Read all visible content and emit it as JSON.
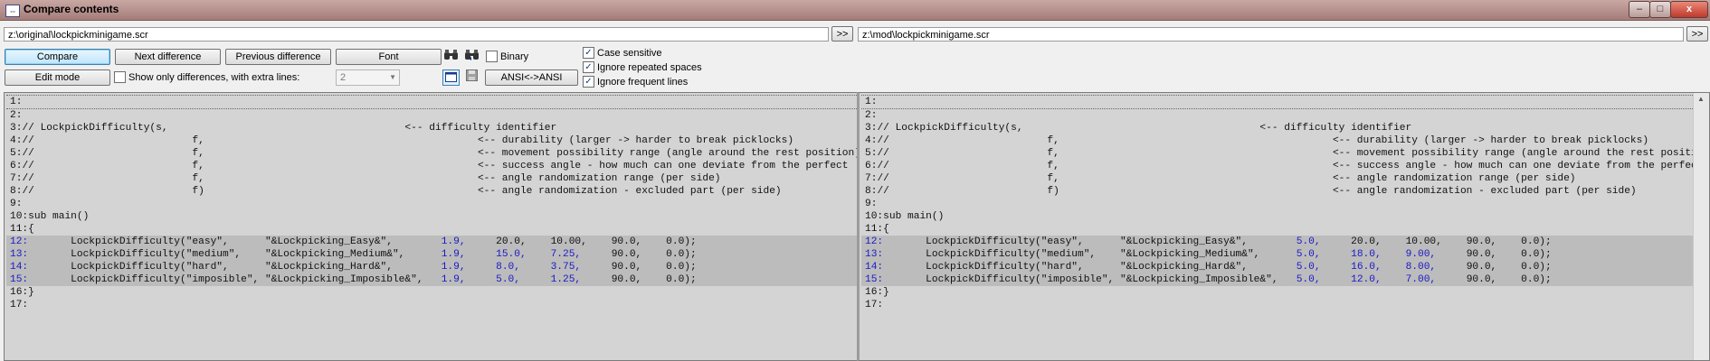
{
  "window": {
    "title": "Compare contents",
    "minimize": "–",
    "maximize": "□",
    "close": "x"
  },
  "files": {
    "left": "z:\\original\\lockpickminigame.scr",
    "right": "z:\\mod\\lockpickminigame.scr",
    "browse_label": ">>"
  },
  "toolbar": {
    "compare": "Compare",
    "next_difference": "Next difference",
    "previous_difference": "Previous difference",
    "font": "Font",
    "edit_mode": "Edit mode",
    "ansi": "ANSI<->ANSI",
    "extra_lines_value": "2"
  },
  "options": {
    "binary": {
      "label": "Binary",
      "checked": false
    },
    "show_only_differences": {
      "label": "Show only differences, with extra lines:",
      "checked": false
    },
    "case_sensitive": {
      "label": "Case sensitive",
      "checked": true
    },
    "ignore_repeated_spaces": {
      "label": "Ignore repeated spaces",
      "checked": true
    },
    "ignore_frequent_lines": {
      "label": "Ignore frequent lines",
      "checked": true
    }
  },
  "left_lines": [
    {
      "n": "1:",
      "t": ""
    },
    {
      "n": "2:",
      "t": ""
    },
    {
      "n": "3:",
      "t": "// LockpickDifficulty(s,                                       <-- difficulty identifier"
    },
    {
      "n": "4:",
      "t": "//                          f,                                             <-- durability (larger -> harder to break picklocks)"
    },
    {
      "n": "5:",
      "t": "//                          f,                                             <-- movement possibility range (angle around the rest position)"
    },
    {
      "n": "6:",
      "t": "//                          f,                                             <-- success angle - how much can one deviate from the perfect"
    },
    {
      "n": "7:",
      "t": "//                          f,                                             <-- angle randomization range (per side)"
    },
    {
      "n": "8:",
      "t": "//                          f)                                             <-- angle randomization - excluded part (per side)"
    },
    {
      "n": "9:",
      "t": ""
    },
    {
      "n": "10:",
      "t": "sub main()"
    },
    {
      "n": "11:",
      "t": "{"
    },
    {
      "n": "12:",
      "t": "       LockpickDifficulty(\"easy\",      \"&Lockpicking_Easy&\",        ",
      "v": [
        "1.9,",
        "20.0,",
        "10.00,",
        "90.0,",
        "0.0);"
      ]
    },
    {
      "n": "13:",
      "t": "       LockpickDifficulty(\"medium\",    \"&Lockpicking_Medium&\",      ",
      "v": [
        "1.9,",
        "15.0,",
        "7.25,",
        "90.0,",
        "0.0);"
      ]
    },
    {
      "n": "14:",
      "t": "       LockpickDifficulty(\"hard\",      \"&Lockpicking_Hard&\",        ",
      "v": [
        "1.9,",
        "8.0,",
        "3.75,",
        "90.0,",
        "0.0);"
      ]
    },
    {
      "n": "15:",
      "t": "       LockpickDifficulty(\"imposible\", \"&Lockpicking_Imposible&\",   ",
      "v": [
        "1.9,",
        "5.0,",
        "1.25,",
        "90.0,",
        "0.0);"
      ]
    },
    {
      "n": "16:",
      "t": "}"
    },
    {
      "n": "17:",
      "t": ""
    }
  ],
  "right_lines": [
    {
      "n": "1:",
      "t": ""
    },
    {
      "n": "2:",
      "t": ""
    },
    {
      "n": "3:",
      "t": "// LockpickDifficulty(s,                                       <-- difficulty identifier"
    },
    {
      "n": "4:",
      "t": "//                          f,                                             <-- durability (larger -> harder to break picklocks)"
    },
    {
      "n": "5:",
      "t": "//                          f,                                             <-- movement possibility range (angle around the rest position)"
    },
    {
      "n": "6:",
      "t": "//                          f,                                             <-- success angle - how much can one deviate from the perfect"
    },
    {
      "n": "7:",
      "t": "//                          f,                                             <-- angle randomization range (per side)"
    },
    {
      "n": "8:",
      "t": "//                          f)                                             <-- angle randomization - excluded part (per side)"
    },
    {
      "n": "9:",
      "t": ""
    },
    {
      "n": "10:",
      "t": "sub main()"
    },
    {
      "n": "11:",
      "t": "{"
    },
    {
      "n": "12:",
      "t": "       LockpickDifficulty(\"easy\",      \"&Lockpicking_Easy&\",        ",
      "v": [
        "5.0,",
        "20.0,",
        "10.00,",
        "90.0,",
        "0.0);"
      ]
    },
    {
      "n": "13:",
      "t": "       LockpickDifficulty(\"medium\",    \"&Lockpicking_Medium&\",      ",
      "v": [
        "5.0,",
        "18.0,",
        "9.00,",
        "90.0,",
        "0.0);"
      ]
    },
    {
      "n": "14:",
      "t": "       LockpickDifficulty(\"hard\",      \"&Lockpicking_Hard&\",        ",
      "v": [
        "5.0,",
        "16.0,",
        "8.00,",
        "90.0,",
        "0.0);"
      ]
    },
    {
      "n": "15:",
      "t": "       LockpickDifficulty(\"imposible\", \"&Lockpicking_Imposible&\",   ",
      "v": [
        "5.0,",
        "12.0,",
        "7.00,",
        "90.0,",
        "0.0);"
      ]
    },
    {
      "n": "16:",
      "t": "}"
    },
    {
      "n": "17:",
      "t": ""
    }
  ],
  "colors": {
    "diff_number": "#1818c8",
    "diff_background": "#bcbcbc",
    "pane_background": "#d4d4d4"
  },
  "icons": [
    "app-icon",
    "binoculars-icon",
    "binoculars-back-icon",
    "window-icon",
    "save-icon",
    "chevron-down-icon"
  ]
}
